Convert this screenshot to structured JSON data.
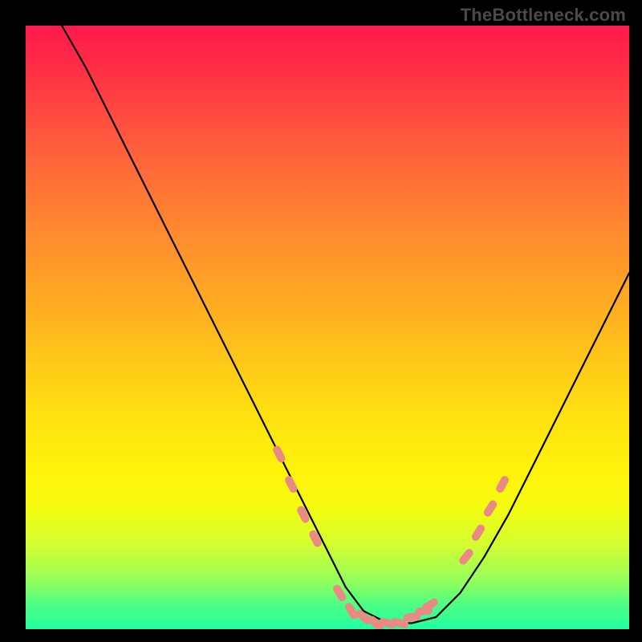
{
  "watermark": "TheBottleneck.com",
  "chart_data": {
    "type": "line",
    "title": "",
    "xlabel": "",
    "ylabel": "",
    "xlim": [
      0,
      100
    ],
    "ylim": [
      0,
      100
    ],
    "grid": false,
    "legend": false,
    "background": "gradient-red-to-green",
    "series": [
      {
        "name": "bottleneck-curve",
        "x": [
          6,
          10,
          14,
          18,
          22,
          26,
          30,
          34,
          38,
          42,
          46,
          50,
          53,
          56,
          60,
          64,
          68,
          72,
          76,
          80,
          84,
          88,
          92,
          96,
          100
        ],
        "y": [
          100,
          93,
          85,
          77,
          69,
          61,
          53,
          45,
          37,
          29,
          21,
          13,
          7,
          3,
          1,
          1,
          2,
          6,
          12,
          19,
          27,
          35,
          43,
          51,
          59
        ]
      }
    ],
    "markers": [
      {
        "name": "left-cluster-start",
        "x": 42,
        "y": 29
      },
      {
        "name": "left-cluster-a",
        "x": 44,
        "y": 24
      },
      {
        "name": "left-cluster-b",
        "x": 46,
        "y": 19
      },
      {
        "name": "left-cluster-c",
        "x": 48,
        "y": 15
      },
      {
        "name": "valley-left-a",
        "x": 52,
        "y": 6
      },
      {
        "name": "valley-left-b",
        "x": 54,
        "y": 3
      },
      {
        "name": "valley-left-c",
        "x": 56,
        "y": 2
      },
      {
        "name": "valley-bottom-a",
        "x": 58,
        "y": 1
      },
      {
        "name": "valley-bottom-b",
        "x": 60,
        "y": 1
      },
      {
        "name": "valley-bottom-c",
        "x": 62,
        "y": 1
      },
      {
        "name": "valley-right-a",
        "x": 64,
        "y": 2
      },
      {
        "name": "valley-right-b",
        "x": 66,
        "y": 3
      },
      {
        "name": "valley-right-c",
        "x": 67,
        "y": 4
      },
      {
        "name": "right-cluster-a",
        "x": 73,
        "y": 12
      },
      {
        "name": "right-cluster-b",
        "x": 75,
        "y": 16
      },
      {
        "name": "right-cluster-c",
        "x": 77,
        "y": 20
      },
      {
        "name": "right-cluster-end",
        "x": 79,
        "y": 24
      }
    ],
    "gradient_stops": [
      {
        "pos": 0.0,
        "color": "#ff1a4d"
      },
      {
        "pos": 0.5,
        "color": "#ffd018"
      },
      {
        "pos": 0.8,
        "color": "#f4fb10"
      },
      {
        "pos": 1.0,
        "color": "#21ffa0"
      }
    ]
  }
}
